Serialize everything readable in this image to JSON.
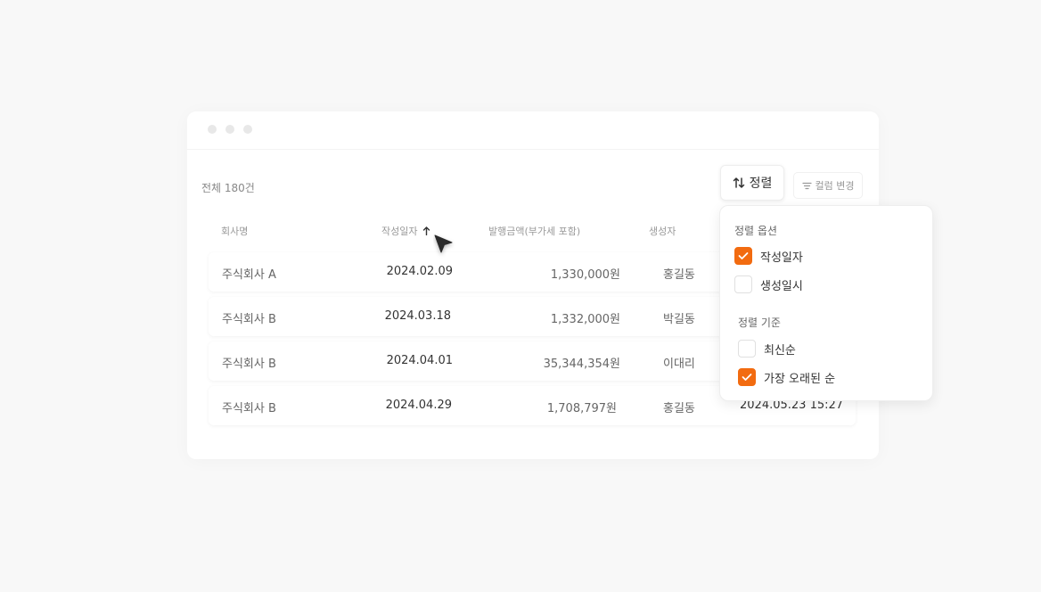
{
  "toolbar": {
    "total_count": "전체 180건",
    "sort_label": "정렬",
    "column_label": "컬럼 변경"
  },
  "table": {
    "headers": [
      "회사명",
      "작성일자",
      "발행금액(부가세 포함)",
      "생성자"
    ],
    "sorted_column_index": 1,
    "sort_direction": "ascending",
    "rows": [
      {
        "company": "주식회사 A",
        "date": "2024.02.09",
        "amount": "1,330,000원",
        "creator": "홍길동",
        "created": ""
      },
      {
        "company": "주식회사 B",
        "date": "2024.03.18",
        "amount": "1,332,000원",
        "creator": "박길동",
        "created": ""
      },
      {
        "company": "주식회사 B",
        "date": "2024.04.01",
        "amount": "35,344,354원",
        "creator": "이대리",
        "created": ""
      },
      {
        "company": "주식회사 B",
        "date": "2024.04.29",
        "amount": "1,708,797원",
        "creator": "홍길동",
        "created": "2024.05.23 15:27"
      }
    ]
  },
  "sort_menu": {
    "options_title": "정렬 옵션",
    "options": [
      {
        "label": "작성일자",
        "checked": true
      },
      {
        "label": "생성일시",
        "checked": false
      }
    ],
    "order_title": "정렬 기준",
    "orders": [
      {
        "label": "최신순",
        "checked": false
      },
      {
        "label": "가장 오래된 순",
        "checked": true
      }
    ]
  },
  "colors": {
    "accent": "#f26b10",
    "background": "#f8f8f8",
    "panel": "#ffffff",
    "muted_text": "#999999"
  },
  "icons": {
    "sort_button": "sort-arrows-icon",
    "column_button": "filter-lines-icon",
    "sorted_header": "arrow-up-icon",
    "check": "check-icon",
    "pointer": "mouse-cursor-icon"
  }
}
